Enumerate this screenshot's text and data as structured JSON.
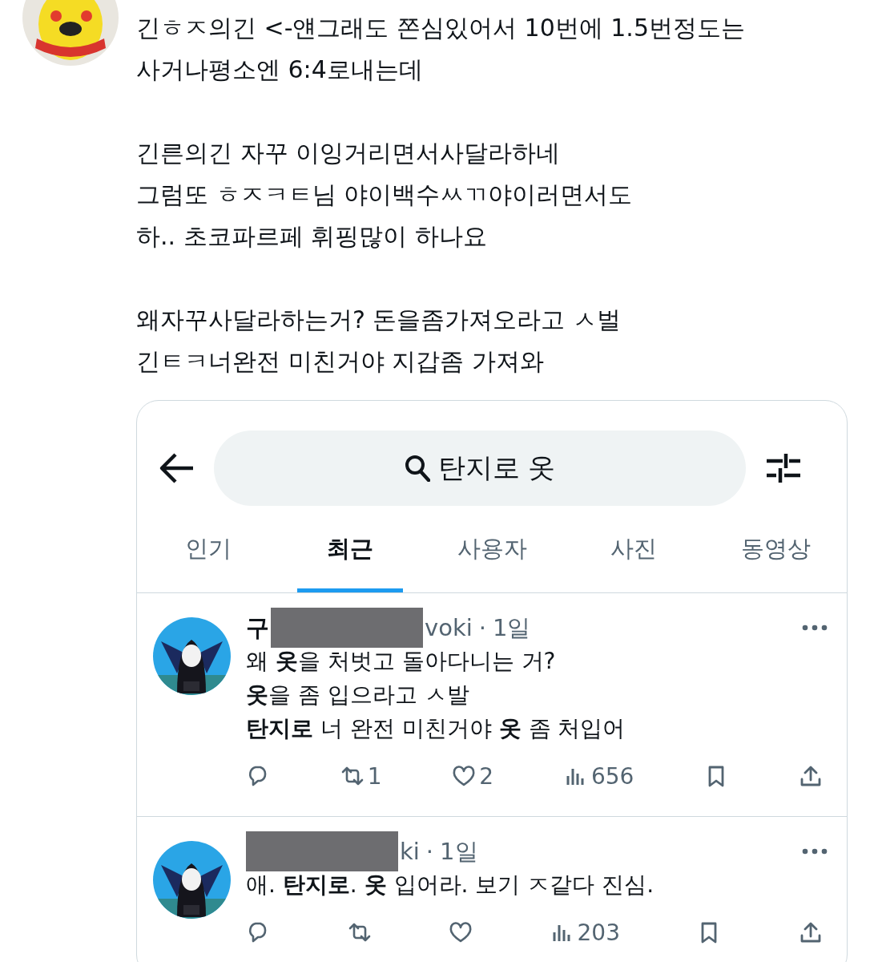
{
  "post": {
    "avatar": {
      "kind": "picture"
    },
    "paragraphs": [
      [
        "긴ㅎㅈ의긴 <-얜그래도 쫀심있어서 10번에 1.5번정도는",
        "사거나평소엔 6:4로내는데"
      ],
      [
        "긴른의긴 자꾸 이잉거리면서사달라하네",
        "그럼또 ㅎㅈㅋㅌ님 야이백수ㅆㄲ야이러면서도",
        "하.. 초코파르페 휘핑많이 하나요"
      ],
      [
        "왜자꾸사달라하는거? 돈을좀가져오라고 ㅅ벌",
        "긴ㅌㅋ너완전 미친거야 지갑좀 가져와"
      ]
    ]
  },
  "screenshot": {
    "search": {
      "value": "탄지로 옷"
    },
    "tabs": [
      {
        "label": "인기",
        "selected": false
      },
      {
        "label": "최근",
        "selected": true
      },
      {
        "label": "사용자",
        "selected": false
      },
      {
        "label": "사진",
        "selected": false
      },
      {
        "label": "동영상",
        "selected": false
      }
    ],
    "tweets": [
      {
        "name_start": "구",
        "name_end": "voki",
        "separator": "·",
        "time": "1일",
        "lines": [
          "왜 **옷**을 처벗고 돌아다니는 거?",
          "**옷**을 좀 입으라고 ㅅ발",
          "**탄지로** 너 완전 미친거야 **옷** 좀 처입어"
        ],
        "actions": [
          {
            "kind": "reply"
          },
          {
            "kind": "retweet",
            "count": "1"
          },
          {
            "kind": "like",
            "count": "2"
          },
          {
            "kind": "views",
            "count": "656"
          },
          {
            "kind": "bookmark"
          },
          {
            "kind": "share"
          }
        ]
      },
      {
        "name_end": "ki",
        "separator": "·",
        "time": "1일",
        "lines": [
          "애. **탄지로**. **옷** 입어라. 보기 ㅈ같다 진심."
        ],
        "actions": [
          {
            "kind": "reply"
          },
          {
            "kind": "retweet"
          },
          {
            "kind": "like"
          },
          {
            "kind": "views",
            "count": "203"
          },
          {
            "kind": "bookmark"
          },
          {
            "kind": "share"
          }
        ]
      }
    ]
  }
}
